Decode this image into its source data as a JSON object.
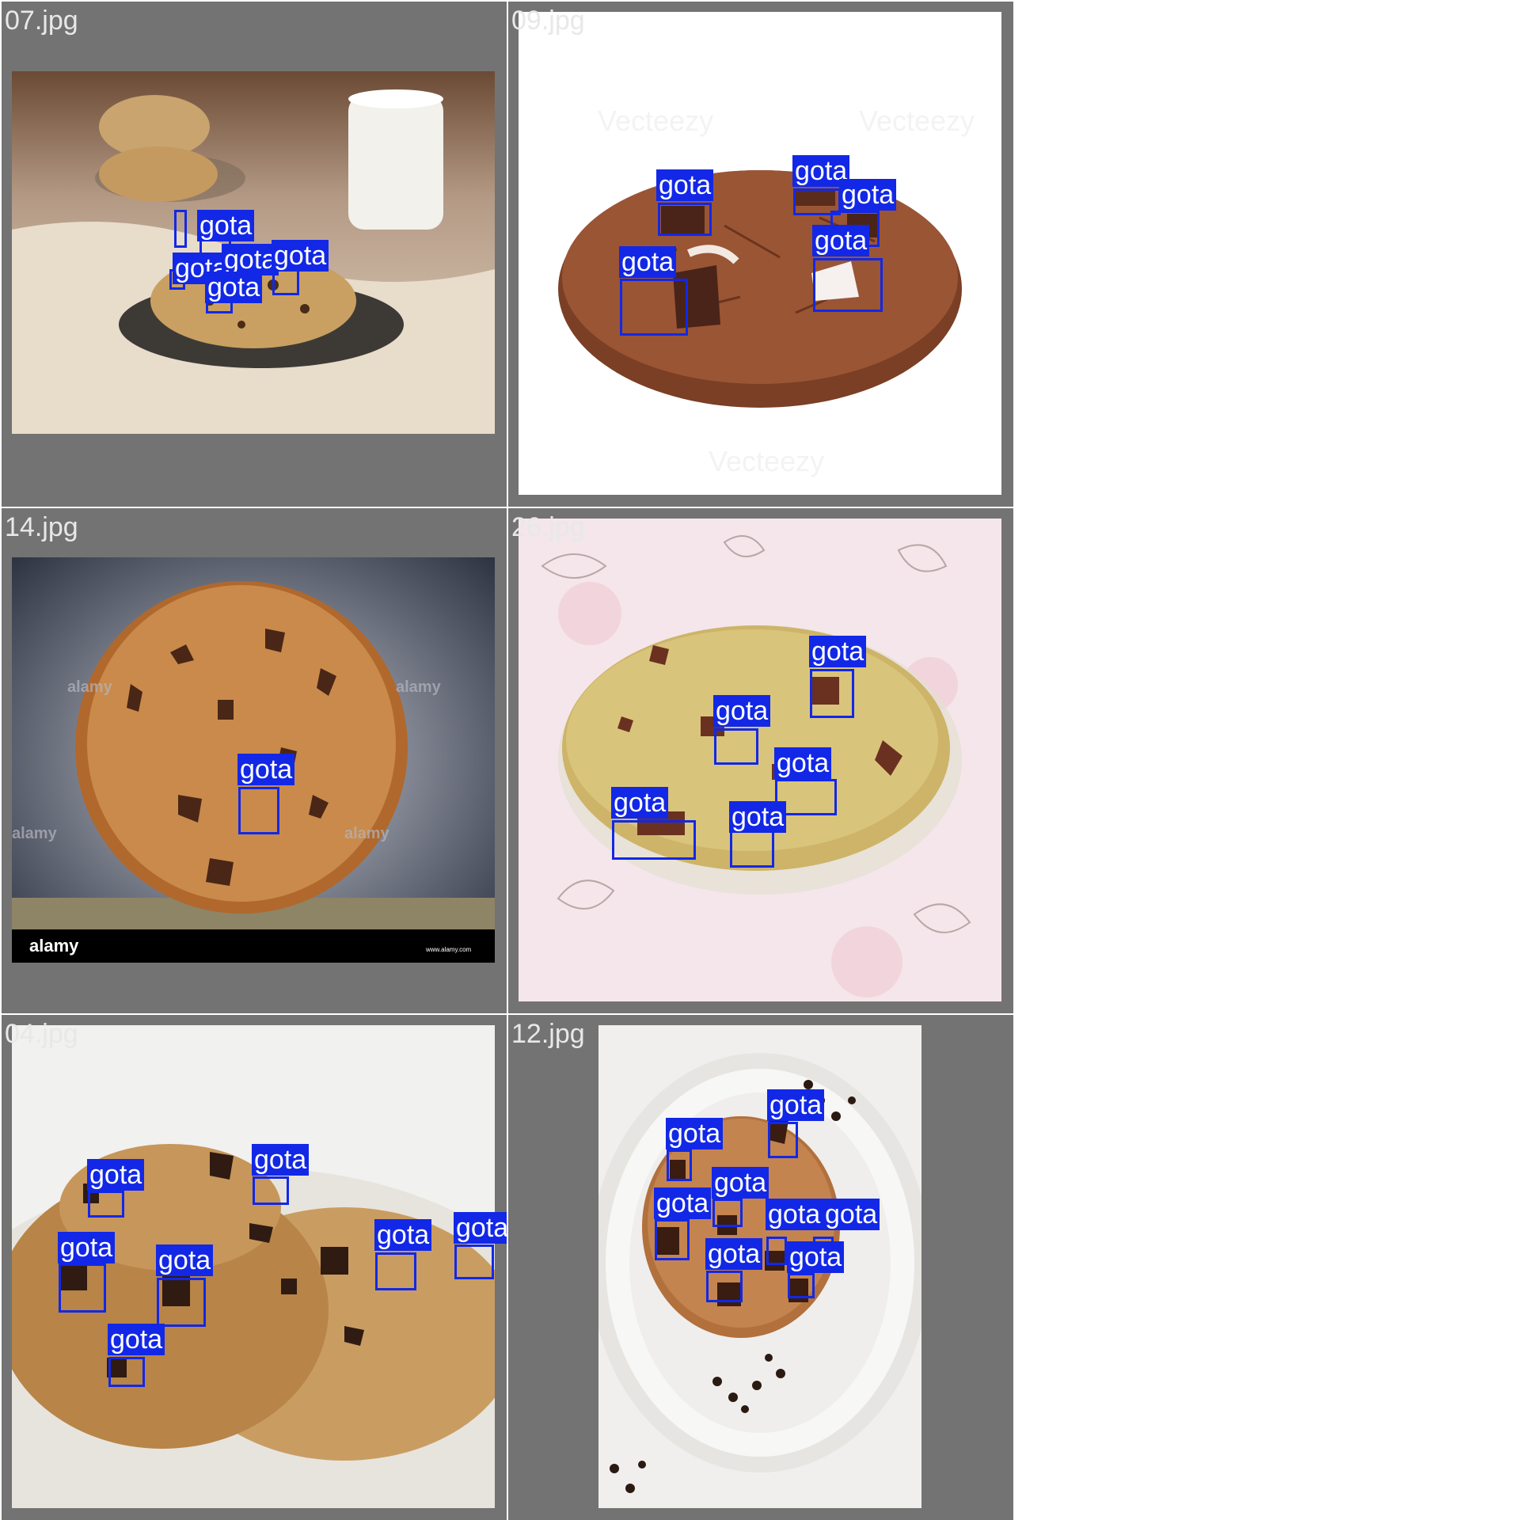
{
  "panels": [
    {
      "filename": "07.jpg",
      "label": "gota"
    },
    {
      "filename": "09.jpg",
      "label": "gota"
    },
    {
      "filename": "14.jpg",
      "label": "gota"
    },
    {
      "filename": "26.jpg",
      "label": "gota"
    },
    {
      "filename": "04.jpg",
      "label": "gota"
    },
    {
      "filename": "12.jpg",
      "label": "gota"
    }
  ],
  "watermarks": {
    "stock_brand": "alamy",
    "stock_site": "www.alamy.com",
    "free_stock": "Vecteezy"
  },
  "colors": {
    "background": "#737373",
    "box": "#1228e6",
    "label_text": "#ffffff"
  }
}
